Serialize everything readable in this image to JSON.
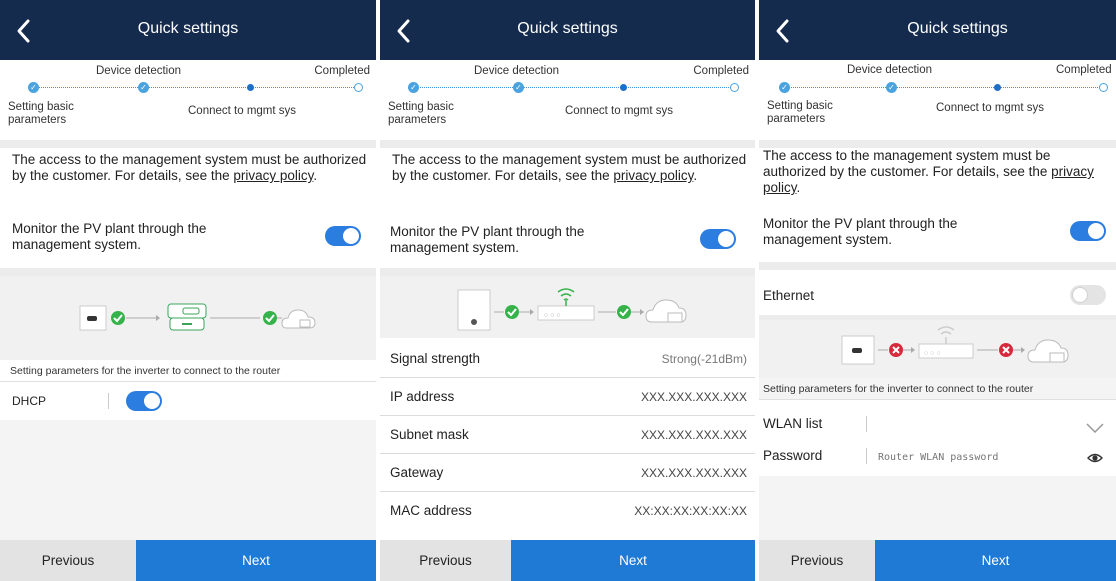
{
  "colors": {
    "header": "#142b4e",
    "accent": "#1f7ad6",
    "toggle_on": "#2b7de0",
    "ok": "#35b34a",
    "error": "#d8283c"
  },
  "panels": [
    {
      "title": "Quick settings",
      "steps": {
        "step2": "Device detection",
        "step4": "Completed",
        "step1": "Setting basic parameters",
        "step3": "Connect to mgmt sys"
      },
      "notice": {
        "text": "The access to the management system must be authorized by the customer. For details, see the ",
        "link": "privacy policy",
        "end": "."
      },
      "monitor_label": "Monitor the PV plant through the management system.",
      "monitor_on": true,
      "graphic_icons": [
        "inverter-icon",
        "check-icon",
        "dongle-icon",
        "check-icon",
        "cloud-icon"
      ],
      "section_caption": "Setting parameters for the inverter to connect to the router",
      "dhcp_label": "DHCP",
      "dhcp_on": true,
      "prev_label": "Previous",
      "next_label": "Next"
    },
    {
      "title": "Quick settings",
      "steps": {
        "step2": "Device detection",
        "step4": "Completed",
        "step1": "Setting basic parameters",
        "step3": "Connect to mgmt sys"
      },
      "notice": {
        "text": "The access to the management system must be authorized by the customer. For details, see the ",
        "link": "privacy policy",
        "end": "."
      },
      "monitor_label": "Monitor the PV plant through the management system.",
      "monitor_on": true,
      "graphic_icons": [
        "inverter-icon",
        "check-icon",
        "wifi-router-icon",
        "check-icon",
        "cloud-icon"
      ],
      "rows": [
        {
          "key": "Signal strength",
          "value": "Strong(-21dBm)"
        },
        {
          "key": "IP address",
          "value": "XXX.XXX.XXX.XXX"
        },
        {
          "key": "Subnet mask",
          "value": "XXX.XXX.XXX.XXX"
        },
        {
          "key": "Gateway",
          "value": "XXX.XXX.XXX.XXX"
        },
        {
          "key": "MAC address",
          "value": "XX:XX:XX:XX:XX:XX"
        }
      ],
      "prev_label": "Previous",
      "next_label": "Next"
    },
    {
      "title": "Quick settings",
      "steps": {
        "step2": "Device detection",
        "step4": "Completed",
        "step1": "Setting basic parameters",
        "step3": "Connect to mgmt sys"
      },
      "notice": {
        "text": "The access to the management system must be authorized by the customer. For details, see the ",
        "link": "privacy policy",
        "end": "."
      },
      "monitor_label": "Monitor the PV plant through the management system.",
      "monitor_on": true,
      "ethernet_label": "Ethernet",
      "ethernet_on": false,
      "graphic_icons": [
        "inverter-icon",
        "error-icon",
        "wifi-router-icon",
        "error-icon",
        "cloud-icon"
      ],
      "section_caption": "Setting parameters for the inverter to connect to the router",
      "wlan_label": "WLAN list",
      "password_label": "Password",
      "password_placeholder": "Router WLAN password",
      "prev_label": "Previous",
      "next_label": "Next"
    }
  ]
}
